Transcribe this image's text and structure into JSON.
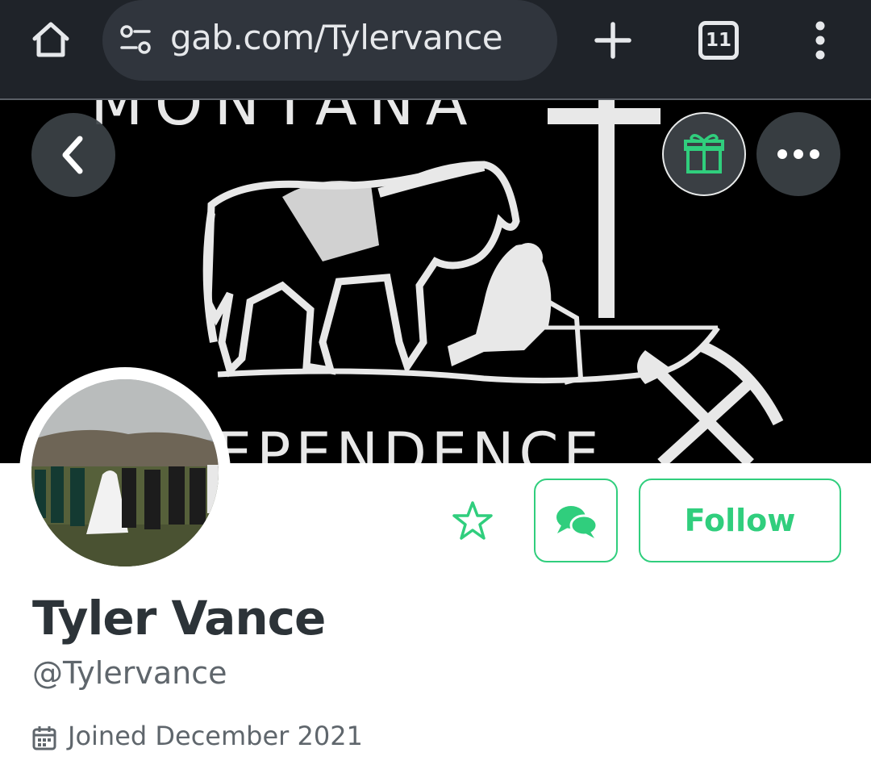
{
  "browser": {
    "url": "gab.com/Tylervance",
    "tab_count": "11",
    "icons": [
      "home-icon",
      "site-info-icon",
      "plus-icon",
      "tab-switcher-icon",
      "kebab-menu-icon"
    ]
  },
  "banner": {
    "top_text": "MONTANA",
    "bottom_text": "EPENDENCE",
    "description_icons": [
      "horse",
      "kneeling-cowboy",
      "cross",
      "shovel",
      "pickaxe"
    ]
  },
  "overlay_buttons": {
    "back_icon": "chevron-left-icon",
    "gift_icon": "gift-icon",
    "more_icon": "more-horizontal-icon"
  },
  "profile": {
    "display_name": "Tyler Vance",
    "username": "@Tylervance",
    "joined": "Joined December 2021",
    "follow_label": "Follow",
    "star_icon": "star-icon",
    "chat_icon": "chat-bubbles-icon"
  },
  "colors": {
    "accent": "#30ce7d",
    "chrome_bg": "#1f2329",
    "urlbar_bg": "#30353d",
    "text_dark": "#2c3338",
    "text_muted": "#5f666c"
  }
}
